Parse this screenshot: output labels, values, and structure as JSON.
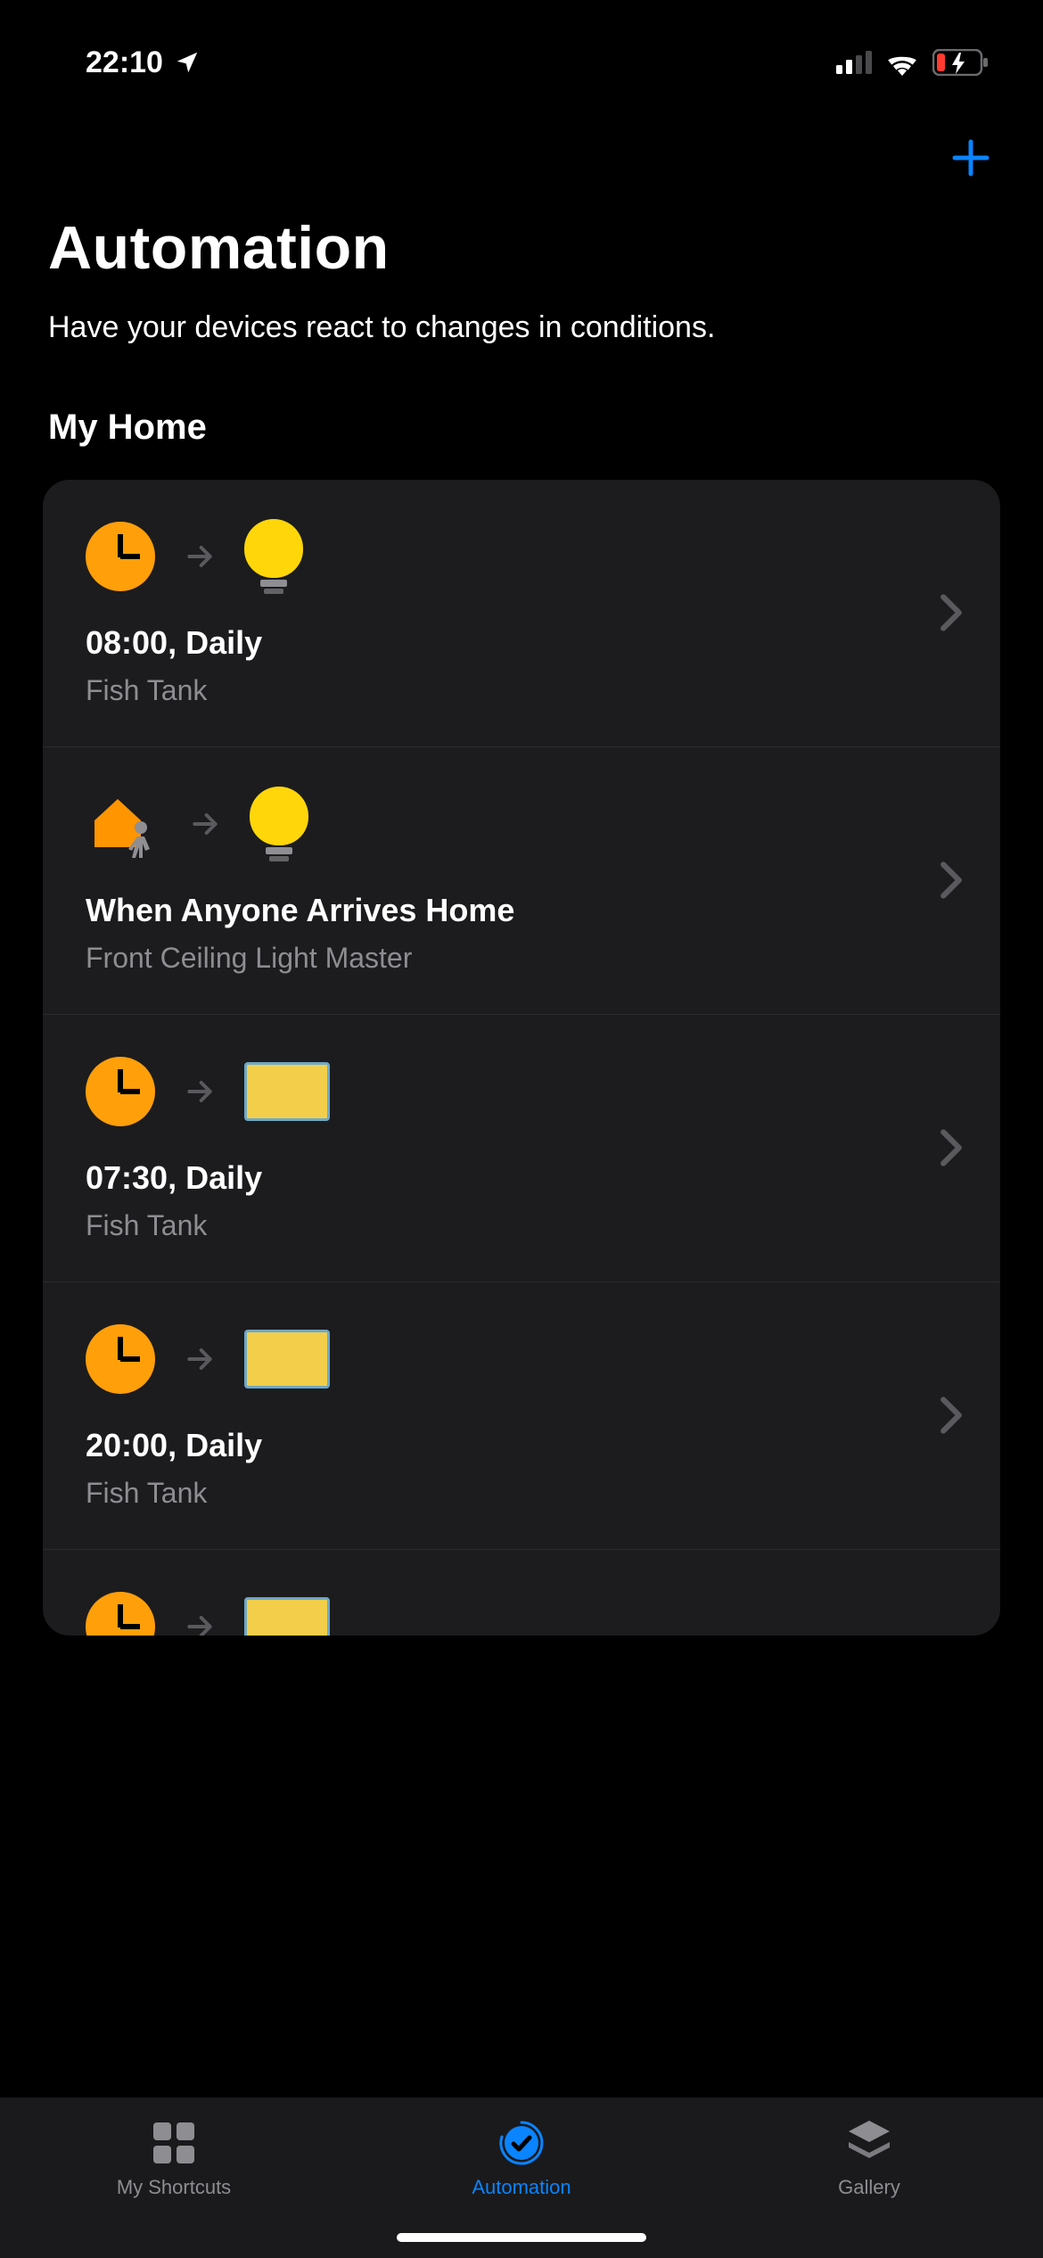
{
  "status": {
    "time": "22:10"
  },
  "nav": {
    "add": "+"
  },
  "header": {
    "title": "Automation",
    "subtitle": "Have your devices react to changes in conditions.",
    "section": "My Home"
  },
  "automations": [
    {
      "trigger_icon": "clock",
      "action_icon": "bulb",
      "title": "08:00, Daily",
      "subtitle": "Fish Tank"
    },
    {
      "trigger_icon": "home-arrive",
      "action_icon": "bulb",
      "title": "When Anyone Arrives Home",
      "subtitle": "Front Ceiling Light Master"
    },
    {
      "trigger_icon": "clock",
      "action_icon": "tank",
      "title": "07:30, Daily",
      "subtitle": "Fish Tank"
    },
    {
      "trigger_icon": "clock",
      "action_icon": "tank",
      "title": "20:00, Daily",
      "subtitle": "Fish Tank"
    },
    {
      "trigger_icon": "clock",
      "action_icon": "tank",
      "title": "",
      "subtitle": ""
    }
  ],
  "tabs": {
    "shortcuts": "My Shortcuts",
    "automation": "Automation",
    "gallery": "Gallery"
  },
  "colors": {
    "accent": "#0a84ff",
    "orange": "#ff9f0a",
    "yellow": "#ffd60a"
  }
}
